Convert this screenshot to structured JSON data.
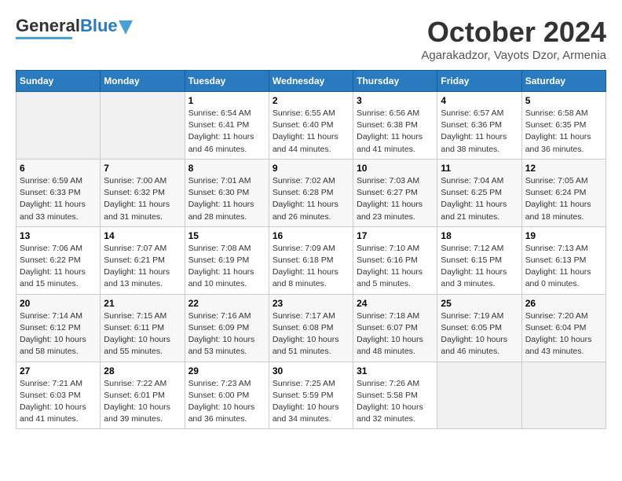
{
  "header": {
    "logo_general": "General",
    "logo_blue": "Blue",
    "month_title": "October 2024",
    "subtitle": "Agarakadzor, Vayots Dzor, Armenia"
  },
  "weekdays": [
    "Sunday",
    "Monday",
    "Tuesday",
    "Wednesday",
    "Thursday",
    "Friday",
    "Saturday"
  ],
  "weeks": [
    [
      {
        "day": "",
        "info": ""
      },
      {
        "day": "",
        "info": ""
      },
      {
        "day": "1",
        "info": "Sunrise: 6:54 AM\nSunset: 6:41 PM\nDaylight: 11 hours and 46 minutes."
      },
      {
        "day": "2",
        "info": "Sunrise: 6:55 AM\nSunset: 6:40 PM\nDaylight: 11 hours and 44 minutes."
      },
      {
        "day": "3",
        "info": "Sunrise: 6:56 AM\nSunset: 6:38 PM\nDaylight: 11 hours and 41 minutes."
      },
      {
        "day": "4",
        "info": "Sunrise: 6:57 AM\nSunset: 6:36 PM\nDaylight: 11 hours and 38 minutes."
      },
      {
        "day": "5",
        "info": "Sunrise: 6:58 AM\nSunset: 6:35 PM\nDaylight: 11 hours and 36 minutes."
      }
    ],
    [
      {
        "day": "6",
        "info": "Sunrise: 6:59 AM\nSunset: 6:33 PM\nDaylight: 11 hours and 33 minutes."
      },
      {
        "day": "7",
        "info": "Sunrise: 7:00 AM\nSunset: 6:32 PM\nDaylight: 11 hours and 31 minutes."
      },
      {
        "day": "8",
        "info": "Sunrise: 7:01 AM\nSunset: 6:30 PM\nDaylight: 11 hours and 28 minutes."
      },
      {
        "day": "9",
        "info": "Sunrise: 7:02 AM\nSunset: 6:28 PM\nDaylight: 11 hours and 26 minutes."
      },
      {
        "day": "10",
        "info": "Sunrise: 7:03 AM\nSunset: 6:27 PM\nDaylight: 11 hours and 23 minutes."
      },
      {
        "day": "11",
        "info": "Sunrise: 7:04 AM\nSunset: 6:25 PM\nDaylight: 11 hours and 21 minutes."
      },
      {
        "day": "12",
        "info": "Sunrise: 7:05 AM\nSunset: 6:24 PM\nDaylight: 11 hours and 18 minutes."
      }
    ],
    [
      {
        "day": "13",
        "info": "Sunrise: 7:06 AM\nSunset: 6:22 PM\nDaylight: 11 hours and 15 minutes."
      },
      {
        "day": "14",
        "info": "Sunrise: 7:07 AM\nSunset: 6:21 PM\nDaylight: 11 hours and 13 minutes."
      },
      {
        "day": "15",
        "info": "Sunrise: 7:08 AM\nSunset: 6:19 PM\nDaylight: 11 hours and 10 minutes."
      },
      {
        "day": "16",
        "info": "Sunrise: 7:09 AM\nSunset: 6:18 PM\nDaylight: 11 hours and 8 minutes."
      },
      {
        "day": "17",
        "info": "Sunrise: 7:10 AM\nSunset: 6:16 PM\nDaylight: 11 hours and 5 minutes."
      },
      {
        "day": "18",
        "info": "Sunrise: 7:12 AM\nSunset: 6:15 PM\nDaylight: 11 hours and 3 minutes."
      },
      {
        "day": "19",
        "info": "Sunrise: 7:13 AM\nSunset: 6:13 PM\nDaylight: 11 hours and 0 minutes."
      }
    ],
    [
      {
        "day": "20",
        "info": "Sunrise: 7:14 AM\nSunset: 6:12 PM\nDaylight: 10 hours and 58 minutes."
      },
      {
        "day": "21",
        "info": "Sunrise: 7:15 AM\nSunset: 6:11 PM\nDaylight: 10 hours and 55 minutes."
      },
      {
        "day": "22",
        "info": "Sunrise: 7:16 AM\nSunset: 6:09 PM\nDaylight: 10 hours and 53 minutes."
      },
      {
        "day": "23",
        "info": "Sunrise: 7:17 AM\nSunset: 6:08 PM\nDaylight: 10 hours and 51 minutes."
      },
      {
        "day": "24",
        "info": "Sunrise: 7:18 AM\nSunset: 6:07 PM\nDaylight: 10 hours and 48 minutes."
      },
      {
        "day": "25",
        "info": "Sunrise: 7:19 AM\nSunset: 6:05 PM\nDaylight: 10 hours and 46 minutes."
      },
      {
        "day": "26",
        "info": "Sunrise: 7:20 AM\nSunset: 6:04 PM\nDaylight: 10 hours and 43 minutes."
      }
    ],
    [
      {
        "day": "27",
        "info": "Sunrise: 7:21 AM\nSunset: 6:03 PM\nDaylight: 10 hours and 41 minutes."
      },
      {
        "day": "28",
        "info": "Sunrise: 7:22 AM\nSunset: 6:01 PM\nDaylight: 10 hours and 39 minutes."
      },
      {
        "day": "29",
        "info": "Sunrise: 7:23 AM\nSunset: 6:00 PM\nDaylight: 10 hours and 36 minutes."
      },
      {
        "day": "30",
        "info": "Sunrise: 7:25 AM\nSunset: 5:59 PM\nDaylight: 10 hours and 34 minutes."
      },
      {
        "day": "31",
        "info": "Sunrise: 7:26 AM\nSunset: 5:58 PM\nDaylight: 10 hours and 32 minutes."
      },
      {
        "day": "",
        "info": ""
      },
      {
        "day": "",
        "info": ""
      }
    ]
  ]
}
